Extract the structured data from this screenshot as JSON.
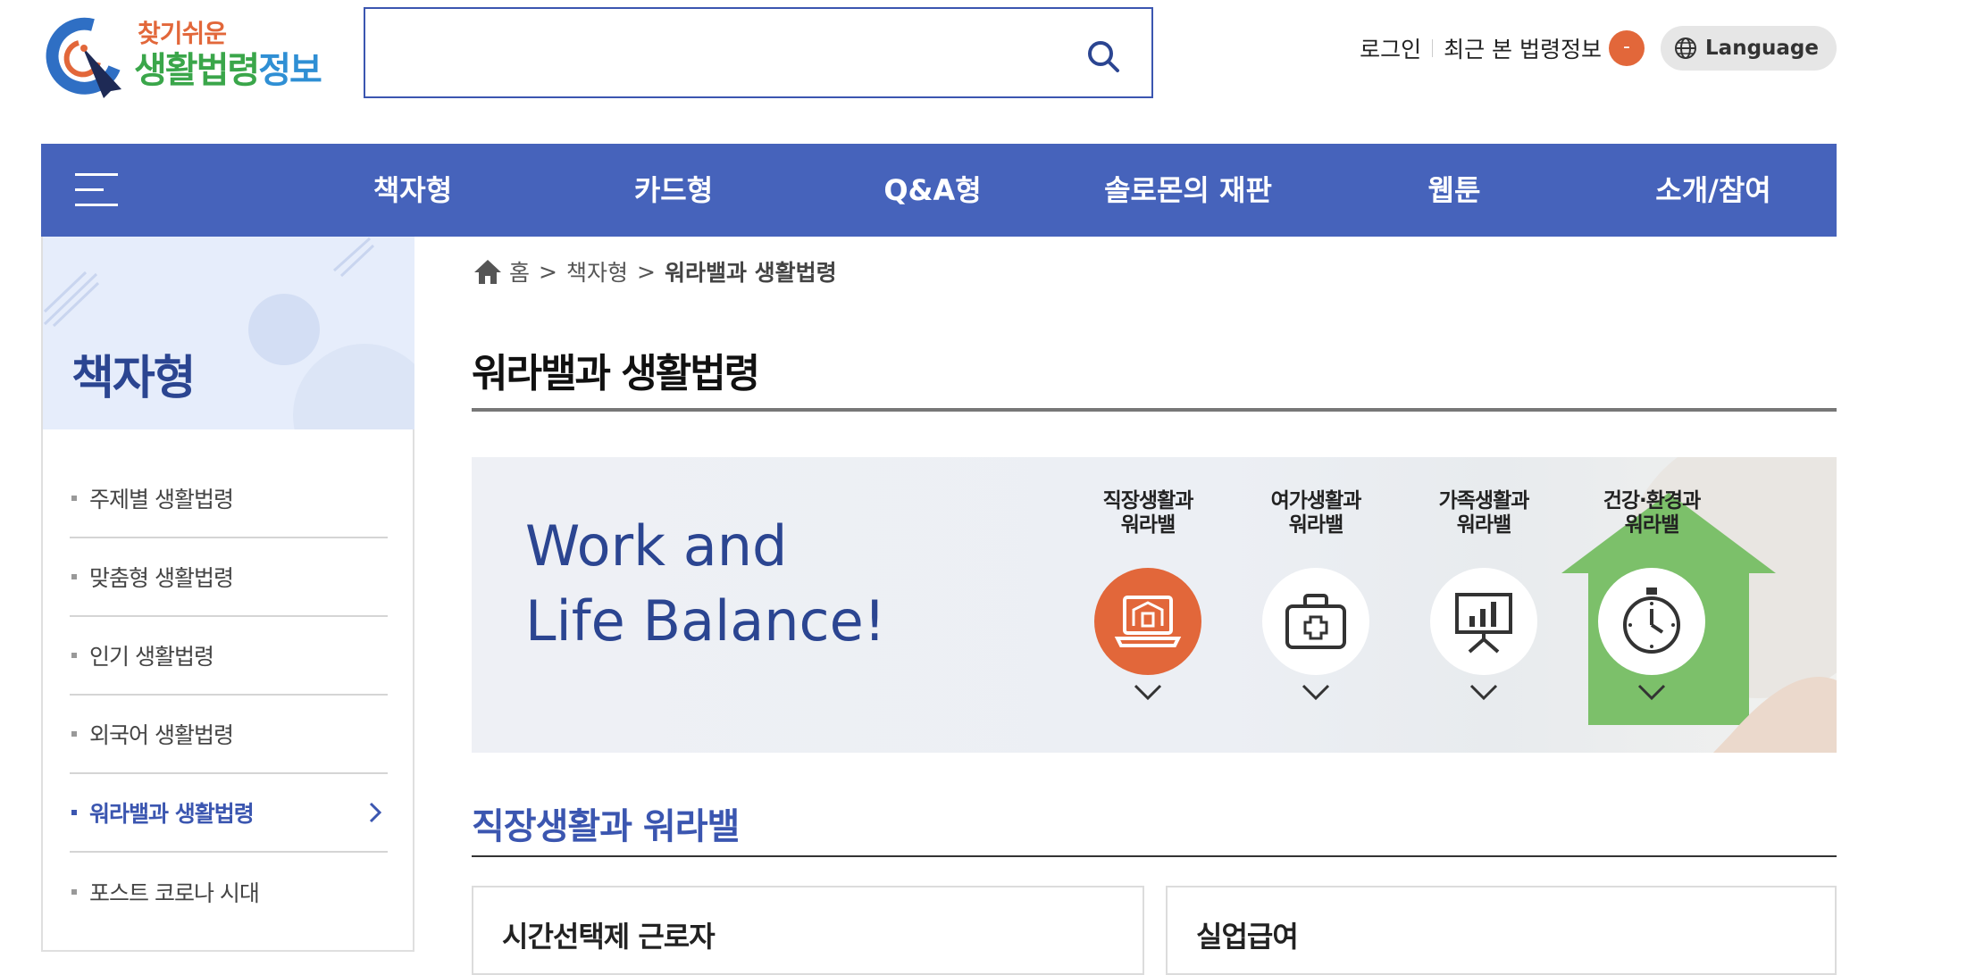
{
  "header": {
    "logo": {
      "line1": "찾기쉬운",
      "line2_part1": "생활법령",
      "line2_part2": "정보"
    },
    "search": {
      "placeholder": "",
      "value": ""
    },
    "util": {
      "login": "로그인",
      "recent": "최근 본 법령정보",
      "recent_count": "-",
      "language": "Language"
    }
  },
  "nav": {
    "items": [
      "책자형",
      "카드형",
      "Q&A형",
      "솔로몬의 재판",
      "웹툰",
      "소개/참여"
    ]
  },
  "sidebar": {
    "title": "책자형",
    "items": [
      {
        "label": "주제별 생활법령",
        "active": false
      },
      {
        "label": "맞춤형 생활법령",
        "active": false
      },
      {
        "label": "인기 생활법령",
        "active": false
      },
      {
        "label": "외국어 생활법령",
        "active": false
      },
      {
        "label": "워라밸과 생활법령",
        "active": true
      },
      {
        "label": "포스트 코로나 시대",
        "active": false
      }
    ]
  },
  "breadcrumb": {
    "home": "홈",
    "sep": ">",
    "level1": "책자형",
    "current": "워라밸과 생활법령"
  },
  "page": {
    "title": "워라밸과 생활법령"
  },
  "banner": {
    "line1": "Work and",
    "line2": "Life Balance!",
    "categories": [
      {
        "line1": "직장생활과",
        "line2": "워라밸",
        "icon": "laptop-office-icon",
        "active": true
      },
      {
        "line1": "여가생활과",
        "line2": "워라밸",
        "icon": "first-aid-kit-icon",
        "active": false
      },
      {
        "line1": "가족생활과",
        "line2": "워라밸",
        "icon": "presentation-board-icon",
        "active": false
      },
      {
        "line1": "건강·환경과",
        "line2": "워라밸",
        "icon": "stopwatch-icon",
        "active": false
      }
    ]
  },
  "section": {
    "title": "직장생활과 워라밸",
    "cards": [
      {
        "title": "시간선택제 근로자"
      },
      {
        "title": "실업급여"
      }
    ]
  },
  "colors": {
    "primary": "#4663bb",
    "accent": "#e2673a",
    "sidebar_bg": "#e6edfb"
  }
}
